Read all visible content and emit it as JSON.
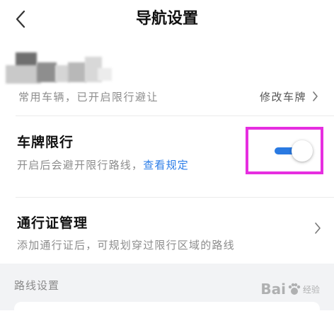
{
  "header": {
    "title": "导航设置"
  },
  "car": {
    "status": "常用车辆，已开启限行避让",
    "modify_label": "修改车牌"
  },
  "restriction": {
    "title": "车牌限行",
    "desc": "开启后会避开限行路线，",
    "link": "查看规定",
    "enabled": true
  },
  "pass": {
    "title": "通行证管理",
    "desc": "添加通行证后，可规划穿过限行区域的路线"
  },
  "route": {
    "section_title": "路线设置"
  },
  "watermark": {
    "brand": "Bai",
    "brand2": "经验"
  },
  "colors": {
    "accent": "#2a7ae2",
    "highlight": "#e62ee0"
  },
  "icons": {
    "back": "back-chevron-icon",
    "chevron": "chevron-right-icon"
  }
}
